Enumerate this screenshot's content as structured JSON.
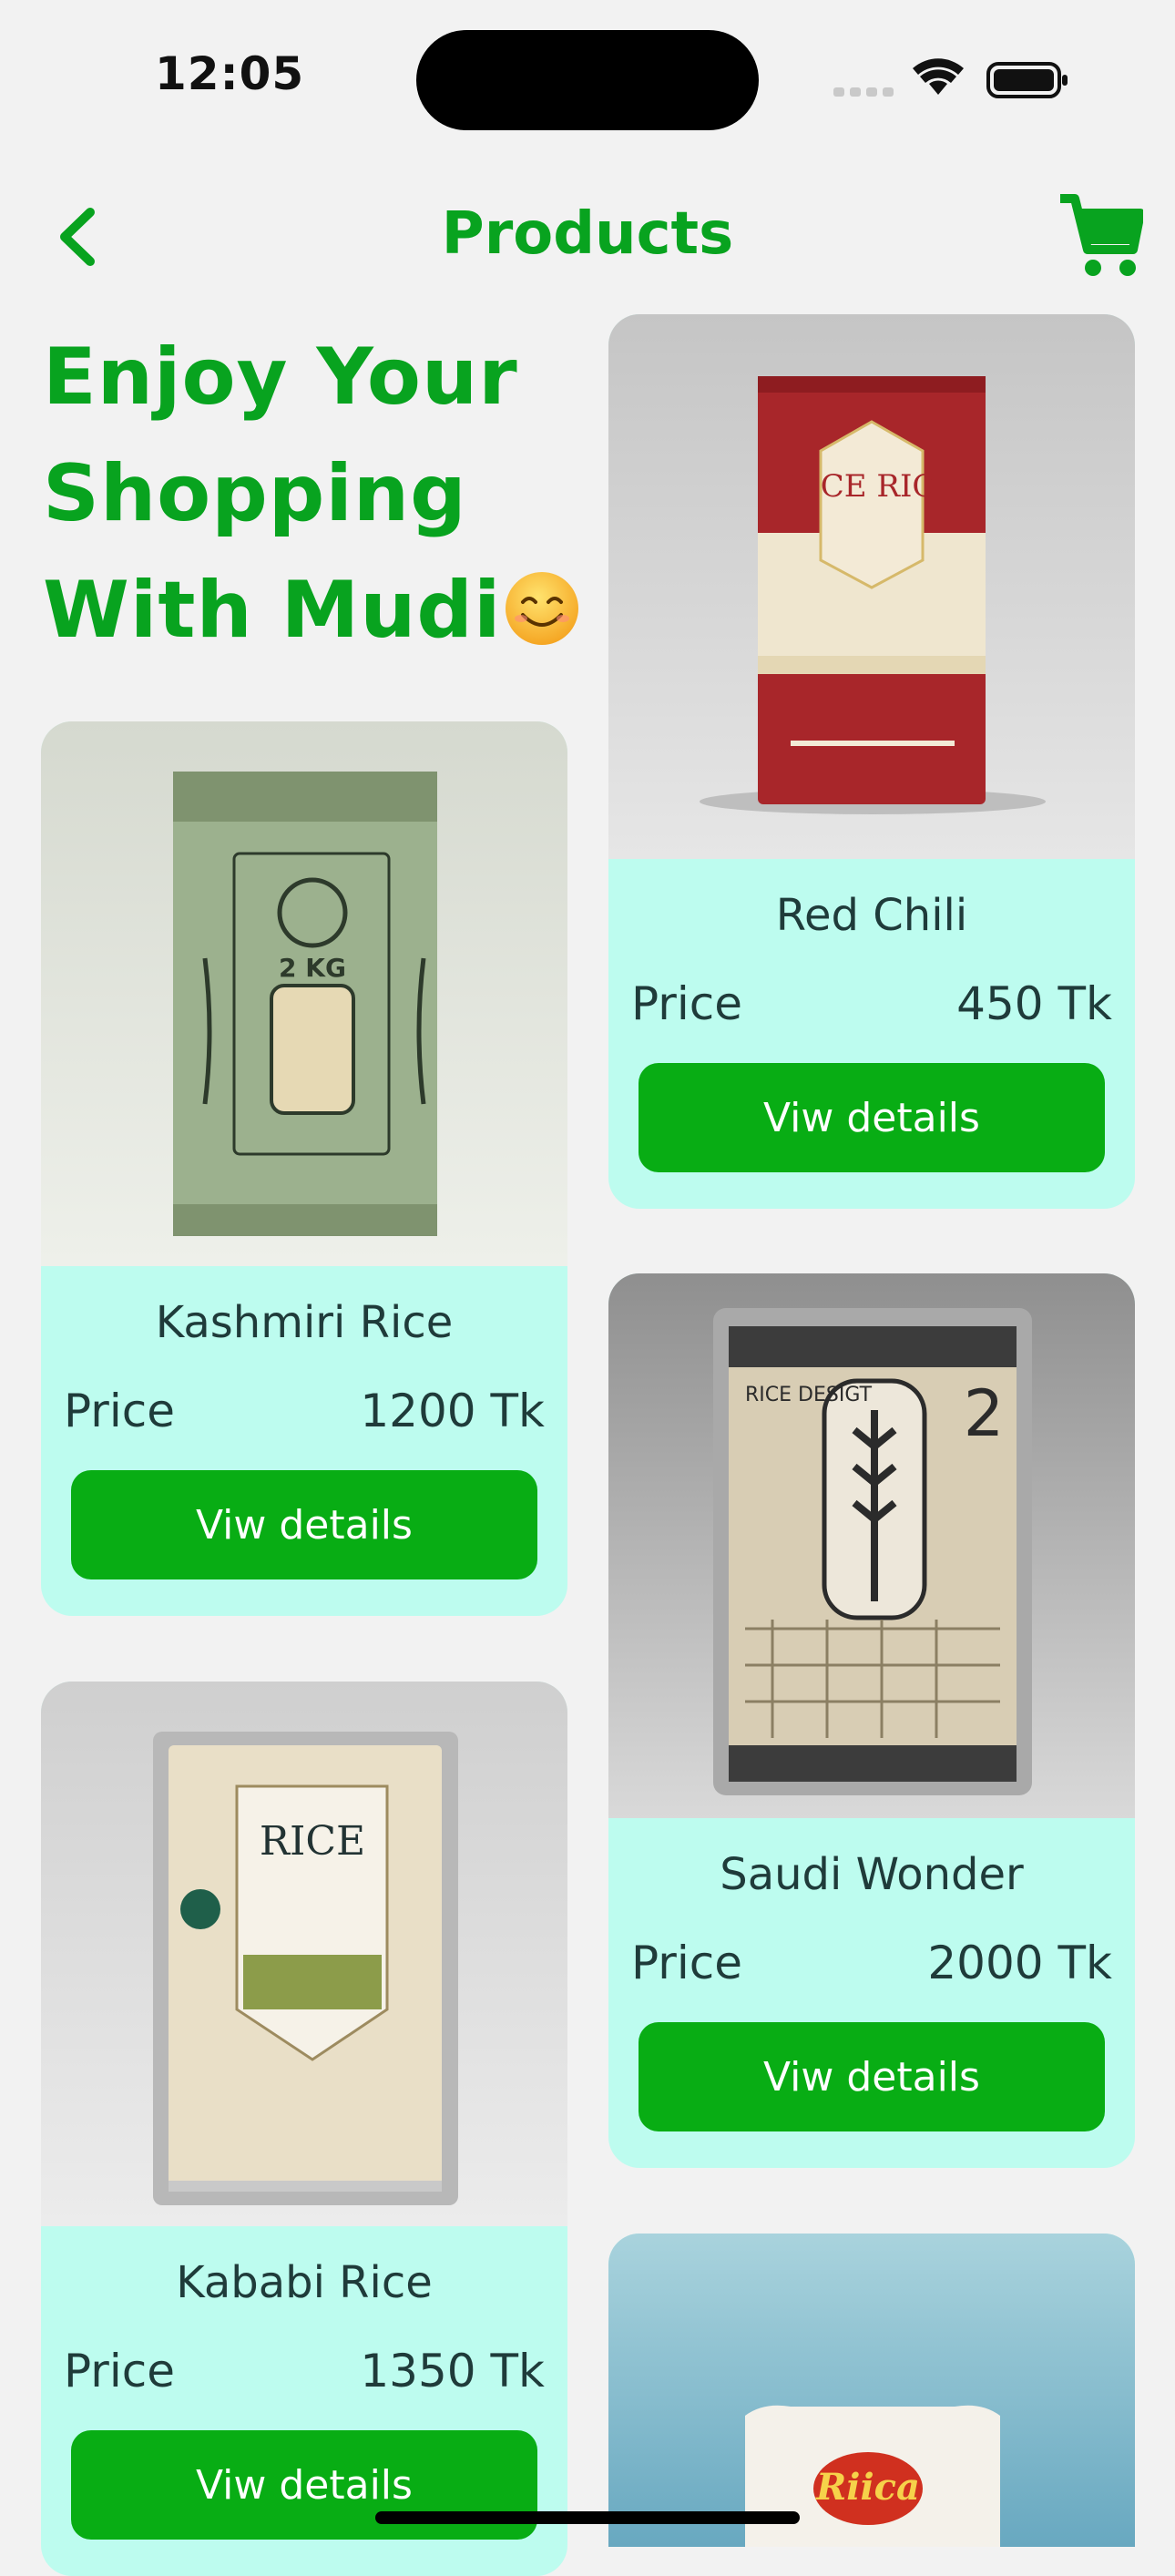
{
  "status_bar": {
    "time": "12:05"
  },
  "nav": {
    "title": "Products"
  },
  "hero": {
    "line1": "Enjoy Your",
    "line2": "Shopping",
    "line3": "With Mudi"
  },
  "products": [
    {
      "name": "Red Chili",
      "price_label": "Price",
      "price": "450 Tk",
      "button": "Viw details",
      "package_text": "RICE RICE"
    },
    {
      "name": "Kashmiri Rice",
      "price_label": "Price",
      "price": "1200 Tk",
      "button": "Viw details",
      "package_text": "2 KG"
    },
    {
      "name": "Saudi Wonder",
      "price_label": "Price",
      "price": "2000 Tk",
      "button": "Viw details",
      "package_text": "RICE DESIGT"
    },
    {
      "name": "Kababi Rice",
      "price_label": "Price",
      "price": "1350 Tk",
      "button": "Viw details",
      "package_text": "RICE"
    },
    {
      "package_text": "Riica"
    }
  ],
  "colors": {
    "accent": "#08a31f",
    "button": "#08ad14",
    "card_bg": "#bdfcef",
    "page_bg": "#f2f2f2"
  }
}
